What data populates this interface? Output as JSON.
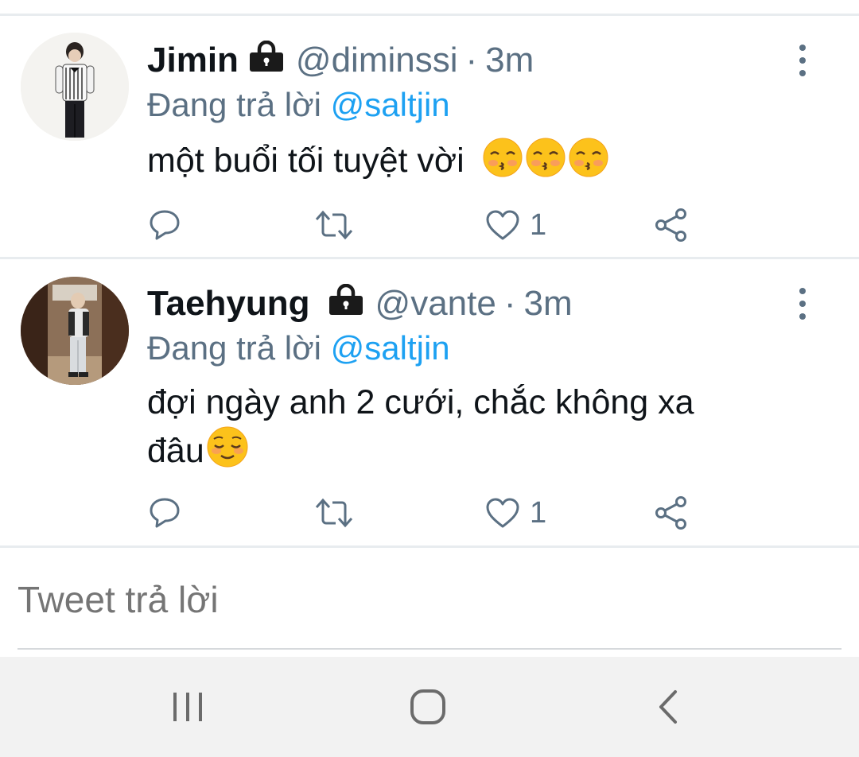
{
  "tweets": [
    {
      "display_name": "Jimin",
      "handle": "@diminssi",
      "separator": "·",
      "time": "3m",
      "replying_prefix": "Đang trả lời",
      "replying_to": "@saltjin",
      "text": "một buổi tối tuyệt vời",
      "emojis": [
        "kissing-face-with-closed-eyes",
        "kissing-face-with-closed-eyes",
        "kissing-face-with-closed-eyes"
      ],
      "like_count": "1",
      "locked": true
    },
    {
      "display_name": "Taehyung",
      "handle": "@vante",
      "separator": "·",
      "time": "3m",
      "replying_prefix": "Đang trả lời",
      "replying_to": "@saltjin",
      "text_line1": "đợi ngày anh 2 cưới, chắc không xa",
      "text_line2": "đâu",
      "emojis": [
        "relieved-face"
      ],
      "like_count": "1",
      "locked": true
    }
  ],
  "composer": {
    "placeholder": "Tweet trả lời"
  },
  "icons": [
    "lock-icon",
    "more-vertical-icon",
    "reply-icon",
    "retweet-icon",
    "heart-icon",
    "share-icon",
    "recents-icon",
    "home-icon",
    "back-icon"
  ],
  "colors": {
    "accent": "#1da1f2",
    "secondary_text": "#5b7083",
    "navbar": "#f2f2f2"
  }
}
